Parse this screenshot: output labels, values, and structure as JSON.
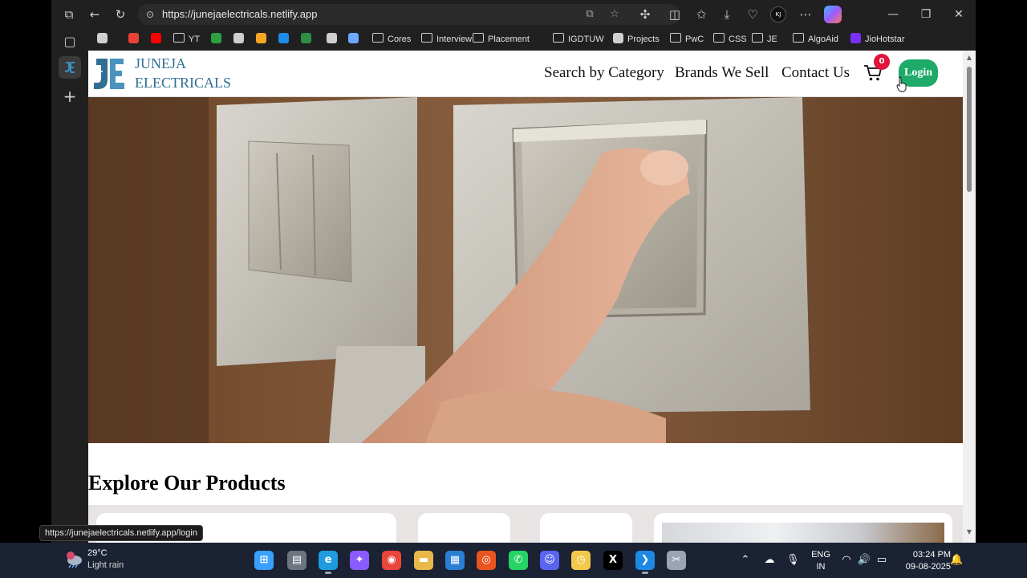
{
  "browser": {
    "url": "https://junejaelectricals.netlify.app",
    "profile_initials": "KJ",
    "status_url": "https://junejaelectricals.netlify.app/login",
    "bookmarks": [
      {
        "label": "",
        "icon": "tab-icon"
      },
      {
        "label": "",
        "icon": "gmail-icon",
        "color": "#ea4335"
      },
      {
        "label": "",
        "icon": "youtube-icon",
        "color": "#ff0000"
      },
      {
        "label": "YT",
        "icon": "folder-icon"
      },
      {
        "label": "",
        "icon": "w-icon",
        "color": "#2ea043"
      },
      {
        "label": "",
        "icon": "chatgpt-icon"
      },
      {
        "label": "",
        "icon": "codeforces-icon",
        "color": "#f5a623"
      },
      {
        "label": "",
        "icon": "bars-icon",
        "color": "#1f8ceb"
      },
      {
        "label": "",
        "icon": "gfg-icon",
        "color": "#2f8d46"
      },
      {
        "label": "",
        "icon": "github-icon"
      },
      {
        "label": "",
        "icon": "rocket-icon",
        "color": "#6ea8ff"
      },
      {
        "label": "Cores",
        "icon": "folder-icon"
      },
      {
        "label": "Interview",
        "icon": "folder-icon"
      },
      {
        "label": "Placement",
        "icon": "folder-icon"
      },
      {
        "label": "IGDTUW",
        "icon": "folder-icon"
      },
      {
        "label": "Projects",
        "icon": "projects-icon"
      },
      {
        "label": "PwC",
        "icon": "folder-icon"
      },
      {
        "label": "CSS",
        "icon": "folder-icon"
      },
      {
        "label": "JE",
        "icon": "folder-icon"
      },
      {
        "label": "AlgoAid",
        "icon": "folder-icon"
      },
      {
        "label": "JioHotstar",
        "icon": "jiohotstar-icon",
        "color": "#7b2ff7"
      }
    ]
  },
  "site": {
    "logo_line1": "JUNEJA",
    "logo_line2": "ELECTRICALS",
    "nav": {
      "category": "Search by Category",
      "brands": "Brands We Sell",
      "contact": "Contact Us"
    },
    "cart_count": "0",
    "login_label": "Login",
    "section_title": "Explore Our Products",
    "colors": {
      "brand": "#2f6f95",
      "login": "#1eaa68",
      "badge": "#e0143c"
    }
  },
  "taskbar": {
    "weather_temp": "29°C",
    "weather_condition": "Light rain",
    "weather_alert": "1",
    "lang_line1": "ENG",
    "lang_line2": "IN",
    "time": "03:24 PM",
    "date": "09-08-2025",
    "apps": [
      "windows-start-icon",
      "file-explorer-icon",
      "edge-icon",
      "copilot-icon",
      "chrome-icon",
      "folder-icon",
      "store-icon",
      "ubuntu-icon",
      "whatsapp-icon",
      "discord-icon",
      "clock-app-icon",
      "x-icon",
      "vscode-icon",
      "snipping-tool-icon"
    ]
  }
}
